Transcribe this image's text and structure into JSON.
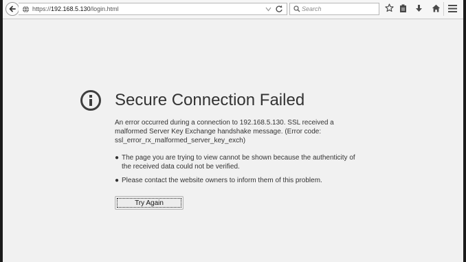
{
  "browser": {
    "url_prefix": "https://",
    "url_host": "192.168.5.130",
    "url_path": "/login.html",
    "search_placeholder": "Search"
  },
  "error": {
    "title": "Secure Connection Failed",
    "description": "An error occurred during a connection to 192.168.5.130. SSL received a malformed Server Key Exchange handshake message. (Error code: ssl_error_rx_malformed_server_key_exch)",
    "bullets": [
      "The page you are trying to view cannot be shown because the authenticity of the received data could not be verified.",
      "Please contact the website owners to inform them of this problem."
    ],
    "try_again_label": "Try Again"
  },
  "icons": {
    "back": "arrow-left-icon",
    "site": "globe-icon",
    "dropdown": "chevron-down-icon",
    "reload": "reload-icon",
    "search": "search-icon",
    "bookmark": "star-icon",
    "reading_list": "clipboard-icon",
    "downloads": "download-icon",
    "home": "home-icon",
    "menu": "hamburger-menu-icon",
    "error": "info-circle-icon"
  },
  "colors": {
    "page_background": "#f1f1f1",
    "text": "#333333",
    "toolbar": "#f6f6f6"
  }
}
